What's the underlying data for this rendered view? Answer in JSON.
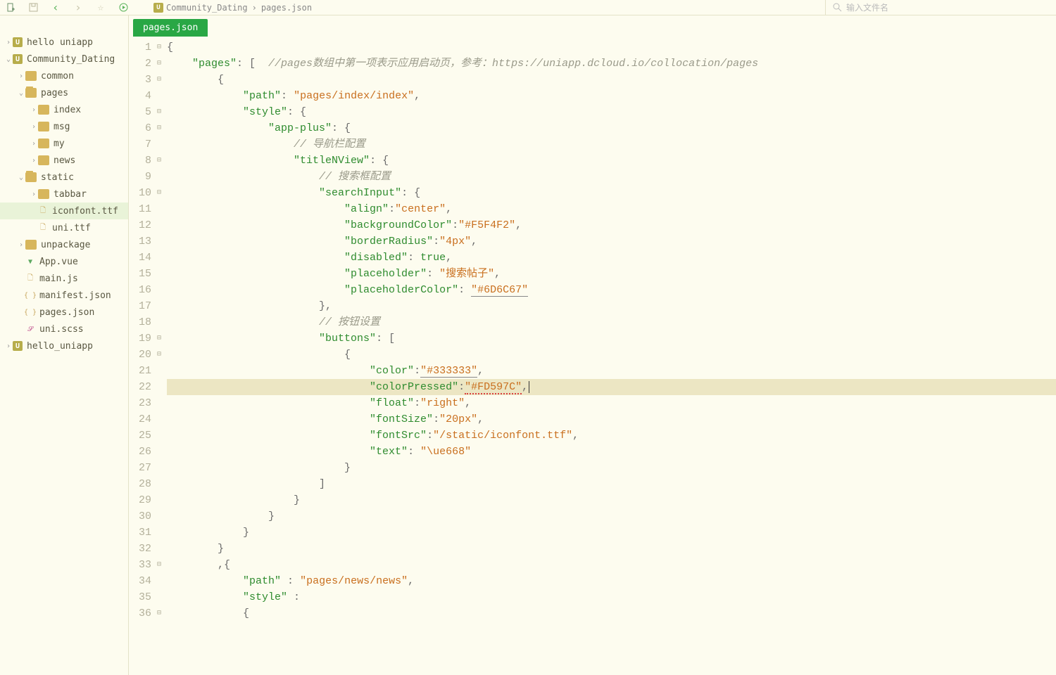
{
  "toolbar": {
    "search_placeholder": "输入文件名"
  },
  "breadcrumb": {
    "project": "Community_Dating",
    "file": "pages.json"
  },
  "tab": {
    "label": "pages.json"
  },
  "sidebar": {
    "items": [
      {
        "d": 0,
        "tw": "›",
        "ico": "u",
        "label": "hello uniapp"
      },
      {
        "d": 0,
        "tw": "⌄",
        "ico": "u",
        "label": "Community_Dating"
      },
      {
        "d": 1,
        "tw": "›",
        "ico": "fold",
        "label": "common"
      },
      {
        "d": 1,
        "tw": "⌄",
        "ico": "fold",
        "label": "pages",
        "open": true
      },
      {
        "d": 2,
        "tw": "›",
        "ico": "fold",
        "label": "index"
      },
      {
        "d": 2,
        "tw": "›",
        "ico": "fold",
        "label": "msg"
      },
      {
        "d": 2,
        "tw": "›",
        "ico": "fold",
        "label": "my"
      },
      {
        "d": 2,
        "tw": "›",
        "ico": "fold",
        "label": "news"
      },
      {
        "d": 1,
        "tw": "⌄",
        "ico": "fold",
        "label": "static",
        "open": true
      },
      {
        "d": 2,
        "tw": "›",
        "ico": "fold",
        "label": "tabbar"
      },
      {
        "d": 2,
        "tw": "",
        "ico": "txt",
        "label": "iconfont.ttf",
        "sel": true
      },
      {
        "d": 2,
        "tw": "",
        "ico": "txt",
        "label": "uni.ttf"
      },
      {
        "d": 1,
        "tw": "›",
        "ico": "fold",
        "label": "unpackage"
      },
      {
        "d": 1,
        "tw": "",
        "ico": "v",
        "label": "App.vue"
      },
      {
        "d": 1,
        "tw": "",
        "ico": "js",
        "label": "main.js"
      },
      {
        "d": 1,
        "tw": "",
        "ico": "json",
        "label": "manifest.json"
      },
      {
        "d": 1,
        "tw": "",
        "ico": "json",
        "label": "pages.json"
      },
      {
        "d": 1,
        "tw": "",
        "ico": "scss",
        "label": "uni.scss"
      },
      {
        "d": 0,
        "tw": "›",
        "ico": "u",
        "label": "hello_uniapp"
      }
    ]
  },
  "code": {
    "lines": [
      {
        "n": 1,
        "f": "⊟",
        "t": [
          [
            "p",
            "{"
          ]
        ]
      },
      {
        "n": 2,
        "f": "⊟",
        "t": [
          [
            "p",
            "    "
          ],
          [
            "k",
            "\"pages\""
          ],
          [
            "p",
            ": [  "
          ],
          [
            "c",
            "//pages数组中第一项表示应用启动页，参考：https://uniapp.dcloud.io/collocation/pages"
          ]
        ]
      },
      {
        "n": 3,
        "f": "⊟",
        "t": [
          [
            "p",
            "        {"
          ]
        ]
      },
      {
        "n": 4,
        "f": "",
        "t": [
          [
            "p",
            "            "
          ],
          [
            "k",
            "\"path\""
          ],
          [
            "p",
            ": "
          ],
          [
            "s",
            "\"pages/index/index\""
          ],
          [
            "p",
            ","
          ]
        ]
      },
      {
        "n": 5,
        "f": "⊟",
        "t": [
          [
            "p",
            "            "
          ],
          [
            "k",
            "\"style\""
          ],
          [
            "p",
            ": {"
          ]
        ]
      },
      {
        "n": 6,
        "f": "⊟",
        "t": [
          [
            "p",
            "                "
          ],
          [
            "k",
            "\"app-plus\""
          ],
          [
            "p",
            ": {"
          ]
        ]
      },
      {
        "n": 7,
        "f": "",
        "t": [
          [
            "p",
            "                    "
          ],
          [
            "c",
            "// 导航栏配置"
          ]
        ]
      },
      {
        "n": 8,
        "f": "⊟",
        "t": [
          [
            "p",
            "                    "
          ],
          [
            "k",
            "\"titleNView\""
          ],
          [
            "p",
            ": {"
          ]
        ]
      },
      {
        "n": 9,
        "f": "",
        "t": [
          [
            "p",
            "                        "
          ],
          [
            "c",
            "// 搜索框配置"
          ]
        ]
      },
      {
        "n": 10,
        "f": "⊟",
        "t": [
          [
            "p",
            "                        "
          ],
          [
            "k",
            "\"searchInput\""
          ],
          [
            "p",
            ": {"
          ]
        ]
      },
      {
        "n": 11,
        "f": "",
        "t": [
          [
            "p",
            "                            "
          ],
          [
            "k",
            "\"align\""
          ],
          [
            "p",
            ":"
          ],
          [
            "s",
            "\"center\""
          ],
          [
            "p",
            ","
          ]
        ]
      },
      {
        "n": 12,
        "f": "",
        "t": [
          [
            "p",
            "                            "
          ],
          [
            "k",
            "\"backgroundColor\""
          ],
          [
            "p",
            ":"
          ],
          [
            "s",
            "\"#F5F4F2\""
          ],
          [
            "p",
            ","
          ]
        ]
      },
      {
        "n": 13,
        "f": "",
        "t": [
          [
            "p",
            "                            "
          ],
          [
            "k",
            "\"borderRadius\""
          ],
          [
            "p",
            ":"
          ],
          [
            "s",
            "\"4px\""
          ],
          [
            "p",
            ","
          ]
        ]
      },
      {
        "n": 14,
        "f": "",
        "t": [
          [
            "p",
            "                            "
          ],
          [
            "k",
            "\"disabled\""
          ],
          [
            "p",
            ": "
          ],
          [
            "n",
            "true"
          ],
          [
            "p",
            ","
          ]
        ]
      },
      {
        "n": 15,
        "f": "",
        "t": [
          [
            "p",
            "                            "
          ],
          [
            "k",
            "\"placeholder\""
          ],
          [
            "p",
            ": "
          ],
          [
            "s",
            "\"搜索帖子\""
          ],
          [
            "p",
            ","
          ]
        ]
      },
      {
        "n": 16,
        "f": "",
        "t": [
          [
            "p",
            "                            "
          ],
          [
            "k",
            "\"placeholderColor\""
          ],
          [
            "p",
            ": "
          ],
          [
            "s warn",
            "\"#6D6C67\""
          ]
        ]
      },
      {
        "n": 17,
        "f": "",
        "t": [
          [
            "p",
            "                        },"
          ]
        ]
      },
      {
        "n": 18,
        "f": "",
        "t": [
          [
            "p",
            "                        "
          ],
          [
            "c",
            "// 按钮设置"
          ]
        ]
      },
      {
        "n": 19,
        "f": "⊟",
        "t": [
          [
            "p",
            "                        "
          ],
          [
            "k",
            "\"buttons\""
          ],
          [
            "p",
            ": ["
          ]
        ]
      },
      {
        "n": 20,
        "f": "⊟",
        "t": [
          [
            "p",
            "                            {"
          ]
        ]
      },
      {
        "n": 21,
        "f": "",
        "t": [
          [
            "p",
            "                                "
          ],
          [
            "k",
            "\"color\""
          ],
          [
            "p",
            ":"
          ],
          [
            "s warn",
            "\"#333333\""
          ],
          [
            "p",
            ","
          ]
        ]
      },
      {
        "n": 22,
        "f": "",
        "hl": true,
        "t": [
          [
            "p",
            "                                "
          ],
          [
            "k",
            "\"colorPressed\""
          ],
          [
            "p",
            ":"
          ],
          [
            "s err",
            "\"#FD597C\""
          ],
          [
            "p",
            ","
          ]
        ]
      },
      {
        "n": 23,
        "f": "",
        "t": [
          [
            "p",
            "                                "
          ],
          [
            "k",
            "\"float\""
          ],
          [
            "p",
            ":"
          ],
          [
            "s",
            "\"right\""
          ],
          [
            "p",
            ","
          ]
        ]
      },
      {
        "n": 24,
        "f": "",
        "t": [
          [
            "p",
            "                                "
          ],
          [
            "k",
            "\"fontSize\""
          ],
          [
            "p",
            ":"
          ],
          [
            "s",
            "\"20px\""
          ],
          [
            "p",
            ","
          ]
        ]
      },
      {
        "n": 25,
        "f": "",
        "t": [
          [
            "p",
            "                                "
          ],
          [
            "k",
            "\"fontSrc\""
          ],
          [
            "p",
            ":"
          ],
          [
            "s",
            "\"/static/iconfont.ttf\""
          ],
          [
            "p",
            ","
          ]
        ]
      },
      {
        "n": 26,
        "f": "",
        "t": [
          [
            "p",
            "                                "
          ],
          [
            "k",
            "\"text\""
          ],
          [
            "p",
            ": "
          ],
          [
            "s",
            "\"\\ue668\""
          ]
        ]
      },
      {
        "n": 27,
        "f": "",
        "t": [
          [
            "p",
            "                            }"
          ]
        ]
      },
      {
        "n": 28,
        "f": "",
        "t": [
          [
            "p",
            "                        ]"
          ]
        ]
      },
      {
        "n": 29,
        "f": "",
        "t": [
          [
            "p",
            "                    }"
          ]
        ]
      },
      {
        "n": 30,
        "f": "",
        "t": [
          [
            "p",
            "                }"
          ]
        ]
      },
      {
        "n": 31,
        "f": "",
        "t": [
          [
            "p",
            "            }"
          ]
        ]
      },
      {
        "n": 32,
        "f": "",
        "t": [
          [
            "p",
            "        }"
          ]
        ]
      },
      {
        "n": 33,
        "f": "⊟",
        "t": [
          [
            "p",
            "        ,{"
          ]
        ]
      },
      {
        "n": 34,
        "f": "",
        "t": [
          [
            "p",
            "            "
          ],
          [
            "k",
            "\"path\""
          ],
          [
            "p",
            " : "
          ],
          [
            "s",
            "\"pages/news/news\""
          ],
          [
            "p",
            ","
          ]
        ]
      },
      {
        "n": 35,
        "f": "",
        "t": [
          [
            "p",
            "            "
          ],
          [
            "k",
            "\"style\""
          ],
          [
            "p",
            " :"
          ]
        ]
      },
      {
        "n": 36,
        "f": "⊟",
        "t": [
          [
            "p",
            "            {"
          ]
        ]
      }
    ]
  }
}
